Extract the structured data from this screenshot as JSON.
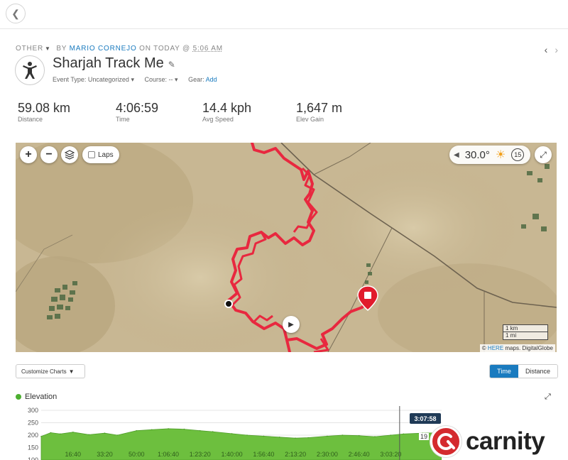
{
  "header": {
    "activity_type": "OTHER",
    "by_text": "BY",
    "author": "MARIO CORNEJO",
    "on_text": "ON TODAY @",
    "time": "5:06 AM",
    "title": "Sharjah Track Me",
    "event_type_label": "Event Type:",
    "event_type_value": "Uncategorized",
    "course_label": "Course:",
    "course_value": "--",
    "gear_label": "Gear:",
    "gear_action": "Add"
  },
  "icons": {
    "back": "chevron-left-icon",
    "activity": "person-figure-icon",
    "edit": "pencil-icon",
    "prev": "chevron-left-icon",
    "next": "chevron-right-icon",
    "zoom_in": "plus-icon",
    "zoom_out": "minus-icon",
    "layers": "layers-icon",
    "weather": "sun-icon",
    "wind": "wind-icon",
    "fullscreen": "expand-icon",
    "play": "play-icon"
  },
  "stats": [
    {
      "value": "59.08 km",
      "label": "Distance"
    },
    {
      "value": "4:06:59",
      "label": "Time"
    },
    {
      "value": "14.4 kph",
      "label": "Avg Speed"
    },
    {
      "value": "1,647 m",
      "label": "Elev Gain"
    }
  ],
  "map": {
    "laps_label": "Laps",
    "temperature": "30.0°",
    "wind_speed": "15",
    "scale_km": "1 km",
    "scale_mi": "1 mi",
    "attribution_copy": "©",
    "attribution_here": "HERE",
    "attribution_maps": "maps.",
    "attribution_globe": "DigitalGlobe",
    "track_color": "#e8283f"
  },
  "chart_controls": {
    "customize_label": "Customize Charts",
    "toggle_time": "Time",
    "toggle_distance": "Distance",
    "active": "Time"
  },
  "chart_data": {
    "type": "area",
    "title": "Elevation",
    "series_color": "#6dbf3e",
    "y_ticks": [
      "300",
      "250",
      "200",
      "150",
      "100"
    ],
    "x_ticks": [
      "16:40",
      "33:20",
      "50:00",
      "1:06:40",
      "1:23:20",
      "1:40:00",
      "1:56:40",
      "2:13:20",
      "2:30:00",
      "2:46:40",
      "3:03:20"
    ],
    "ylim": [
      100,
      300
    ],
    "x_minutes": [
      0,
      5,
      10,
      16.7,
      25,
      33.3,
      40,
      50,
      58,
      66.7,
      75,
      83.3,
      90,
      100,
      108,
      116.7,
      125,
      133.3,
      140,
      150,
      158,
      166.7,
      175,
      183.3,
      190,
      200,
      210
    ],
    "values": [
      195,
      210,
      205,
      212,
      202,
      208,
      200,
      218,
      222,
      226,
      224,
      218,
      214,
      206,
      200,
      196,
      192,
      188,
      190,
      196,
      200,
      198,
      194,
      200,
      205,
      208,
      210
    ],
    "cursor_time": "3:07:58",
    "cursor_value": "19"
  },
  "branding": {
    "logo_text": "carnity"
  }
}
